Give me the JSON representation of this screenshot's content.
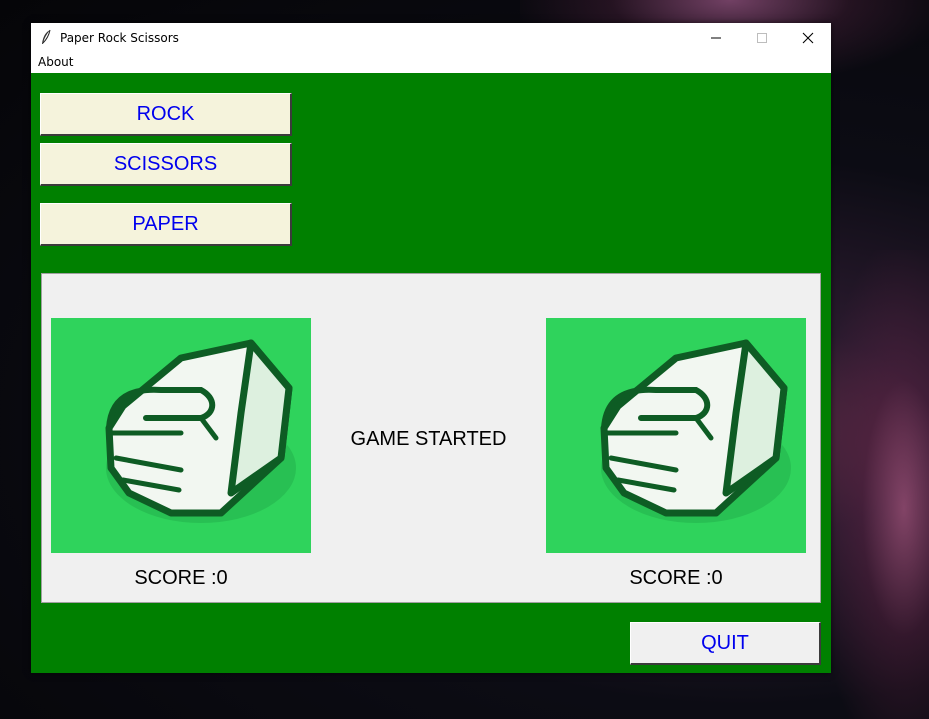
{
  "window": {
    "title": "Paper Rock Scissors",
    "minimize_glyph": "—",
    "maximize_glyph": "☐",
    "close_glyph": "✕"
  },
  "menu": {
    "items": [
      {
        "label": "About"
      }
    ]
  },
  "controls": {
    "rock_label": "ROCK",
    "scissors_label": "SCISSORS",
    "paper_label": "PAPER",
    "quit_label": "QUIT"
  },
  "game": {
    "status": "GAME STARTED",
    "player": {
      "score_label": "SCORE :0",
      "choice_icon": "rock-fist-icon"
    },
    "computer": {
      "score_label": "SCORE :0",
      "choice_icon": "rock-fist-icon"
    }
  },
  "colors": {
    "client_background": "#008000",
    "button_face": "#f5f3dc",
    "button_text": "#0000ee",
    "hand_panel": "#2fd35c"
  }
}
